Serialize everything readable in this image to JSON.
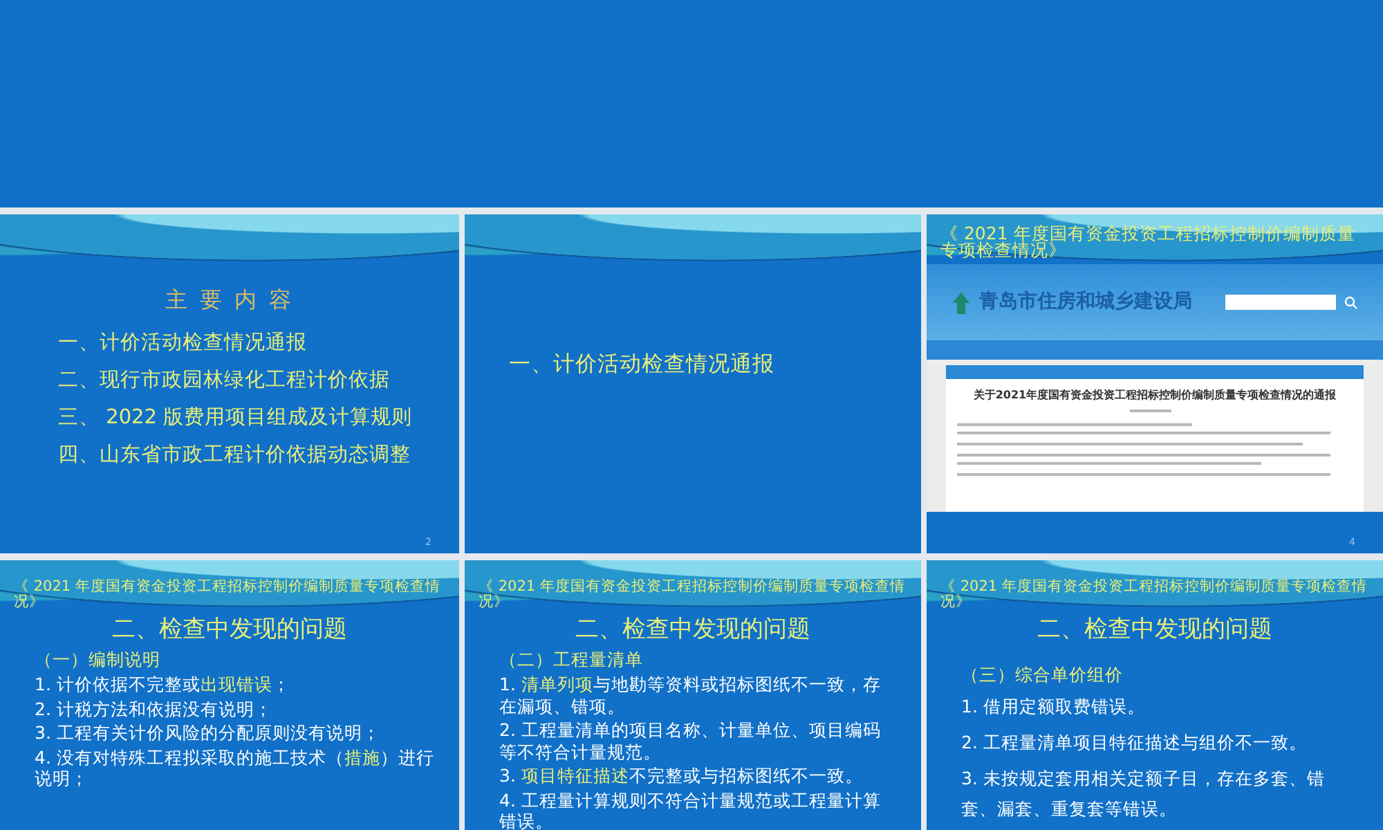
{
  "slides": [
    {
      "kind": "blank"
    },
    {
      "kind": "contents",
      "heading": "主 要 内 容",
      "items": [
        "一、计价活动检查情况通报",
        "二、现行市政园林绿化工程计价依据",
        "三、 2022 版费用项目组成及计算规则",
        "四、山东省市政工程计价依据动态调整"
      ],
      "page_number": "2"
    },
    {
      "kind": "section",
      "heading": "一、计价活动检查情况通报"
    },
    {
      "kind": "screenshot",
      "title": "《 2021 年度国有资金投资工程招标控制价编制质量专项检查情况》",
      "site_name": "青岛市住房和城乡建设局",
      "article_title": "关于2021年度国有资金投资工程招标控制价编制质量专项检查情况的通报",
      "page_number": "4"
    },
    {
      "kind": "issues",
      "title": "《 2021 年度国有资金投资工程招标控制价编制质量专项检查情况》",
      "heading": "二、检查中发现的问题",
      "subheading": "（一）编制说明",
      "items": [
        "1. 计价依据不完整或**出现错误**；",
        "2. 计税方法和依据没有说明；",
        "3. 工程有关计价风险的分配原则没有说明；",
        "4. 没有对特殊工程拟采取的施工技术（**措施**）进行说明；"
      ]
    },
    {
      "kind": "issues",
      "title": "《 2021 年度国有资金投资工程招标控制价编制质量专项检查情况》",
      "heading": "二、检查中发现的问题",
      "subheading": "（二）工程量清单",
      "items": [
        "1. **清单列项**与地勘等资料或招标图纸不一致，存在漏项、错项。",
        "2. 工程量清单的项目名称、计量单位、项目编码等不符合计量规范。",
        "3. **项目特征描述**不完整或与招标图纸不一致。",
        "4. 工程量计算规则不符合计量规范或工程量计算错误。"
      ]
    },
    {
      "kind": "issues",
      "title": "《 2021 年度国有资金投资工程招标控制价编制质量专项检查情况》",
      "heading": "二、检查中发现的问题",
      "subheading": "（三）综合单价组价",
      "items": [
        "1. 借用定额取费错误。",
        "2. 工程量清单项目特征描述与组价不一致。",
        "3. 未按规定套用相关定额子目，存在多套、错套、漏套、重复套等错误。"
      ]
    }
  ]
}
